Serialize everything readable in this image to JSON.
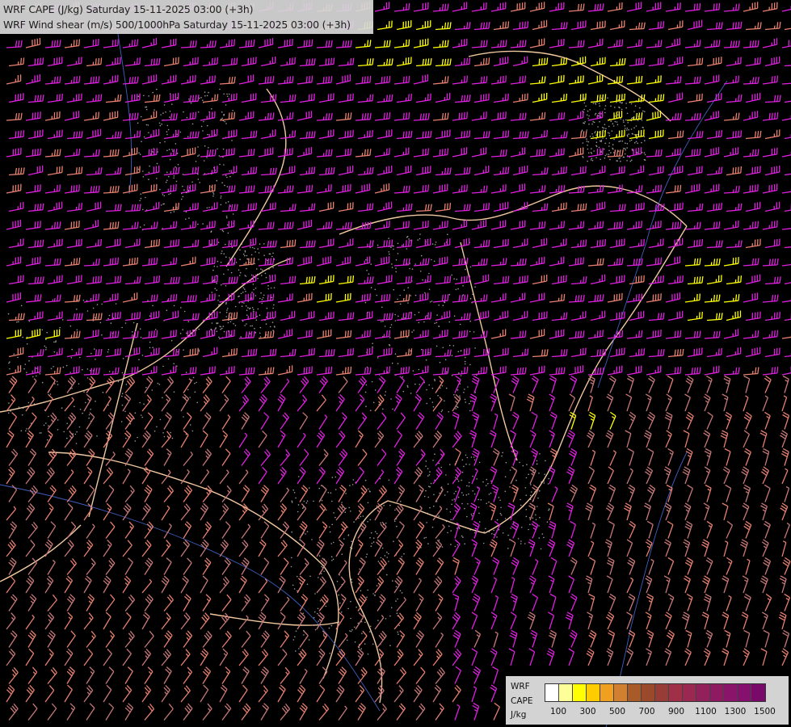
{
  "header": {
    "line1": "WRF CAPE (J/kg) Saturday 15-11-2025 03:00 (+3h)",
    "line2": "WRF Wind shear (m/s) 500/1000hPa Saturday 15-11-2025 03:00 (+3h)"
  },
  "legend": {
    "label_line1": "WRF",
    "label_line2": "CAPE",
    "label_line3": "J/kg",
    "ticks": [
      "100",
      "300",
      "500",
      "700",
      "900",
      "1100",
      "1300",
      "1500"
    ],
    "colors": [
      "#ffffff",
      "#ffff99",
      "#ffff00",
      "#ffcc00",
      "#f0a020",
      "#d08030",
      "#a85a28",
      "#9a4a2a",
      "#983c38",
      "#a03048",
      "#9a2850",
      "#92205a",
      "#8e1a62",
      "#8a146a",
      "#86106e",
      "#7a0a6a"
    ]
  },
  "colors": {
    "background": "#000000",
    "barb_magenta": "#e020e0",
    "barb_salmon": "#e88070",
    "barb_pink": "#c87878",
    "barb_yellow": "#ffff00",
    "borders": "#f0c8a0",
    "rivers": "#4060c0"
  }
}
